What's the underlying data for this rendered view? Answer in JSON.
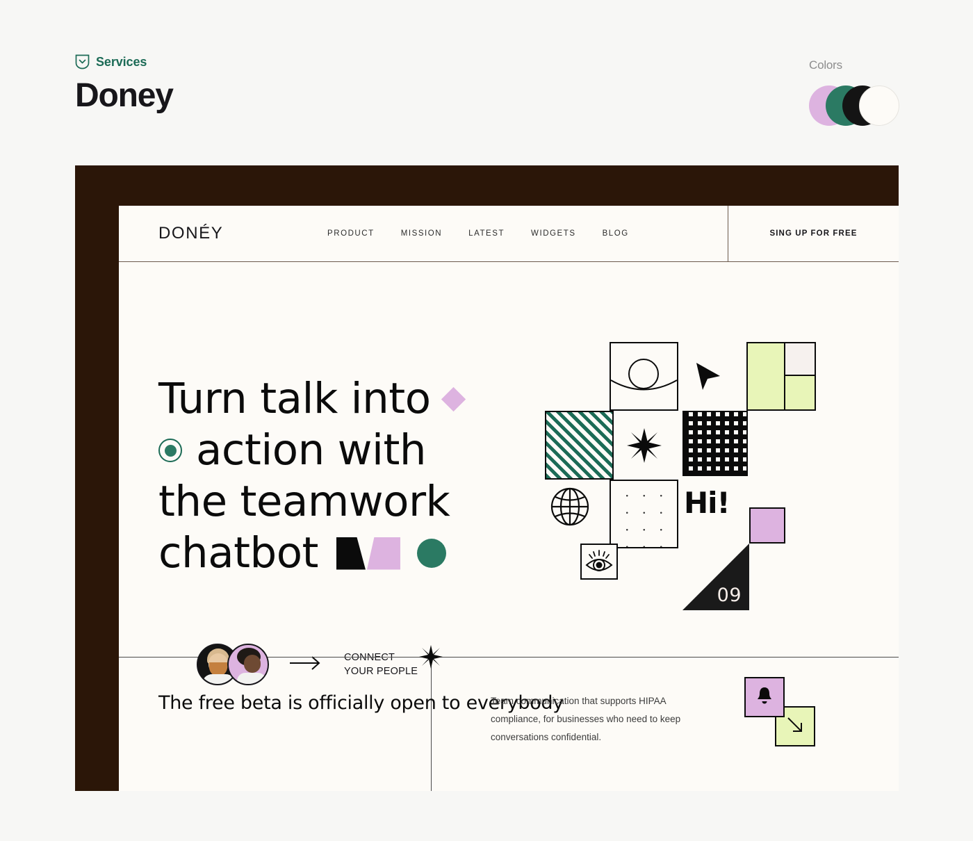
{
  "meta": {
    "services_label": "Services",
    "brand_title": "Doney",
    "colors_label": "Colors",
    "swatches": [
      "#ddb3e0",
      "#2b7a63",
      "#141414",
      "#fdfbf7"
    ]
  },
  "site": {
    "logo": "DONÉY",
    "nav_links": [
      {
        "label": "PRODUCT"
      },
      {
        "label": "MISSION"
      },
      {
        "label": "LATEST"
      },
      {
        "label": "WIDGETS"
      },
      {
        "label": "BLOG"
      }
    ],
    "cta_label": "SING UP FOR FREE"
  },
  "hero": {
    "headline_lines": [
      "Turn talk into",
      "action with",
      "the teamwork",
      "chatbot"
    ],
    "connect_label_line1": "CONNECT",
    "connect_label_line2": "YOUR PEOPLE"
  },
  "collage": {
    "greeting": "Hi!",
    "number": "09",
    "icons": [
      "circle-arc-icon",
      "cursor-icon",
      "star-icon",
      "globe-icon",
      "eye-icon"
    ]
  },
  "bottom": {
    "heading": "The free beta is officially open to everybody",
    "body": "Team communication that supports HIPAA compliance, for businesses who need to keep conversations confidential.",
    "tile_icons": [
      "bell-icon",
      "arrow-down-right-icon"
    ]
  },
  "colors": {
    "frame": "#2b1608",
    "canvas": "#fdfbf7",
    "page_bg": "#f7f7f5",
    "accent_green": "#1c6b56",
    "accent_purple": "#ddb3e0",
    "accent_lime": "#e8f5b8",
    "ink": "#0b0b0b"
  }
}
